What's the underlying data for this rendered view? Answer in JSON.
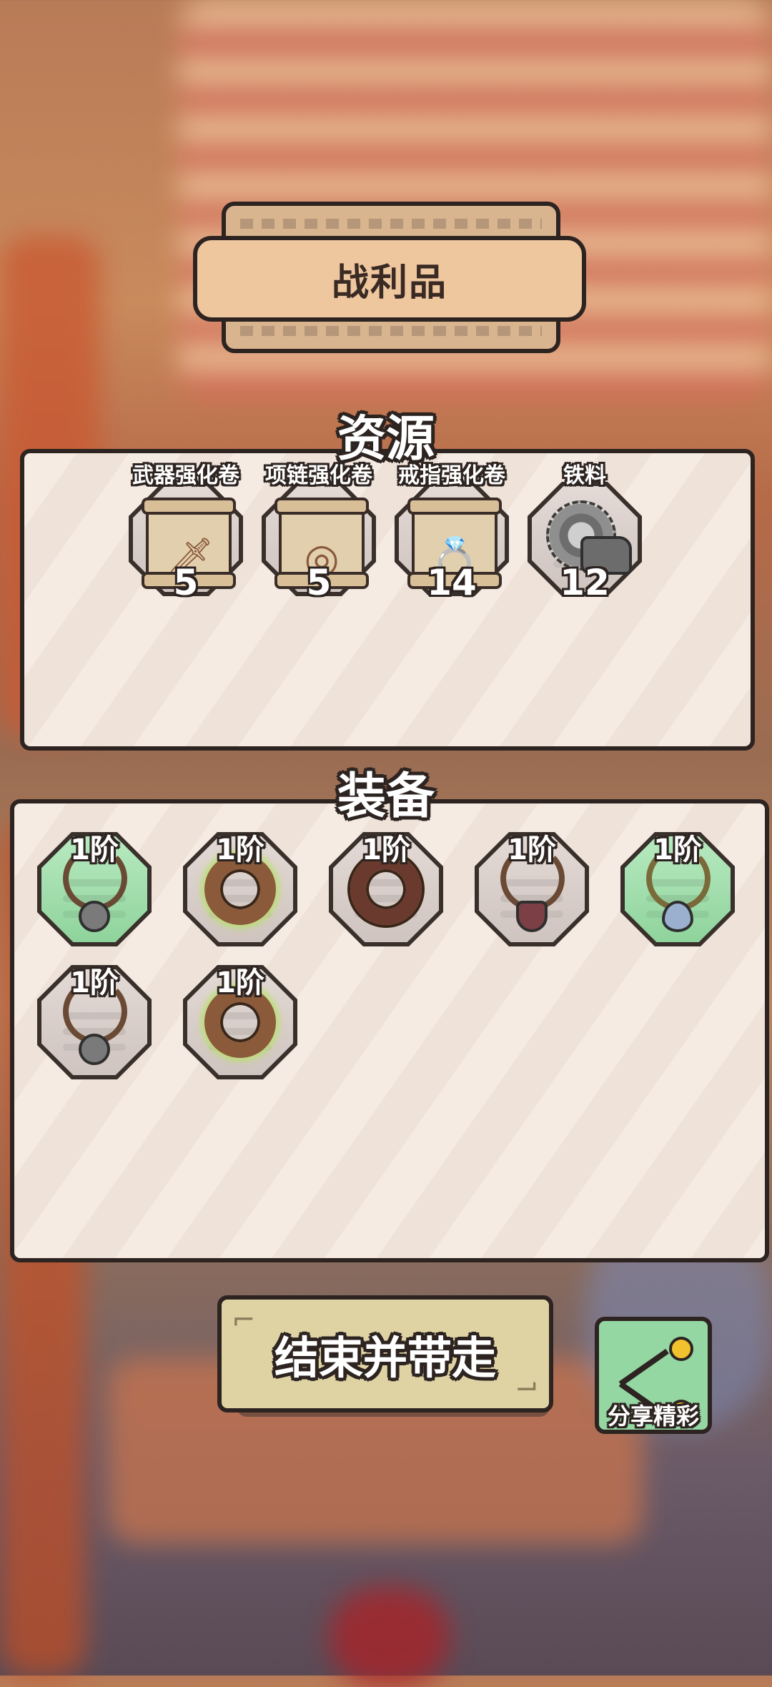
{
  "title": "战利品",
  "resources": {
    "heading": "资源",
    "items": [
      {
        "name": "武器强化卷",
        "count": "5",
        "icon": "weapon-scroll-icon"
      },
      {
        "name": "项链强化卷",
        "count": "5",
        "icon": "necklace-scroll-icon"
      },
      {
        "name": "戒指强化卷",
        "count": "14",
        "icon": "ring-scroll-icon"
      },
      {
        "name": "铁料",
        "count": "12",
        "icon": "iron-material-icon"
      }
    ]
  },
  "equipment": {
    "heading": "装备",
    "items": [
      {
        "tier": "1阶",
        "icon": "saw-pendant-necklace-icon",
        "rarity": "green"
      },
      {
        "tier": "1阶",
        "icon": "vine-ring-icon",
        "rarity": "gray"
      },
      {
        "tier": "1阶",
        "icon": "spiked-ring-icon",
        "rarity": "gray"
      },
      {
        "tier": "1阶",
        "icon": "gem-necklace-icon",
        "rarity": "gray"
      },
      {
        "tier": "1阶",
        "icon": "bead-necklace-icon",
        "rarity": "green"
      },
      {
        "tier": "1阶",
        "icon": "saw-pendant-necklace-icon",
        "rarity": "gray"
      },
      {
        "tier": "1阶",
        "icon": "vine-ring-icon",
        "rarity": "gray"
      }
    ]
  },
  "buttons": {
    "finish": "结束并带走",
    "share": "分享精彩"
  },
  "colors": {
    "outline": "#2d2421",
    "tile_green": "#8fd39c",
    "tile_gray": "#cfc4bf",
    "banner": "#eec79f",
    "share_button": "#95d7a3"
  }
}
